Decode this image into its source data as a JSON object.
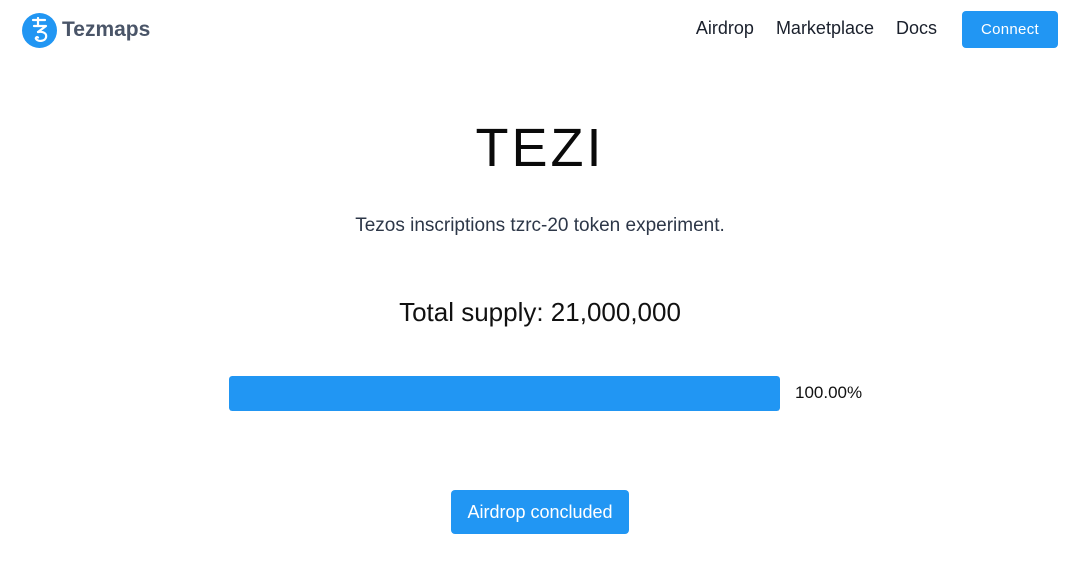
{
  "header": {
    "brand": "Tezmaps",
    "logo_icon": "tezos-logo-icon",
    "nav": [
      {
        "label": "Airdrop"
      },
      {
        "label": "Marketplace"
      },
      {
        "label": "Docs"
      }
    ],
    "connect_label": "Connect"
  },
  "hero": {
    "title": "TEZI",
    "subtitle": "Tezos inscriptions tzrc-20 token experiment.",
    "supply": "Total supply: 21,000,000"
  },
  "progress": {
    "percent": 100,
    "label": "100.00%"
  },
  "airdrop": {
    "status_label": "Airdrop concluded"
  },
  "colors": {
    "accent": "#2196f3",
    "brand_text": "#4a5568"
  }
}
